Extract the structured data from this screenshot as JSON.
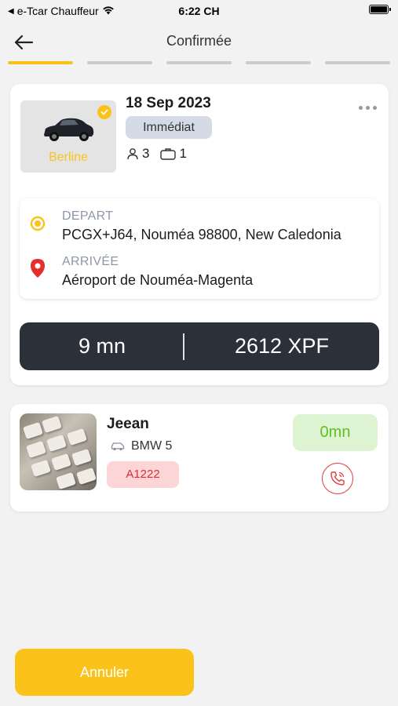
{
  "status_bar": {
    "carrier": "e-Tcar Chauffeur",
    "time": "6:22 CH"
  },
  "nav": {
    "title": "Confirmée",
    "back_icon": "arrow-left-icon"
  },
  "progress": {
    "total_steps": 5,
    "active_step": 1,
    "accent": "#fbc31a"
  },
  "ride": {
    "car_type": "Berline",
    "date": "18 Sep 2023",
    "badge": "Immédiat",
    "passengers": "3",
    "luggage": "1",
    "departure_label": "DEPART",
    "departure_value": "PCGX+J64, Nouméa 98800, New Caledonia",
    "arrival_label": "ARRIVÉE",
    "arrival_value": "Aéroport de Nouméa-Magenta",
    "duration": "9 mn",
    "price": "2612 XPF"
  },
  "driver": {
    "name": "Jeean",
    "vehicle": "BMW 5",
    "plate": "A1222",
    "eta": "0mn"
  },
  "actions": {
    "cancel_label": "Annuler"
  },
  "colors": {
    "accent": "#fbc31a",
    "dark": "#2b303b",
    "danger": "#e02b34",
    "success": "#5fbf24"
  }
}
